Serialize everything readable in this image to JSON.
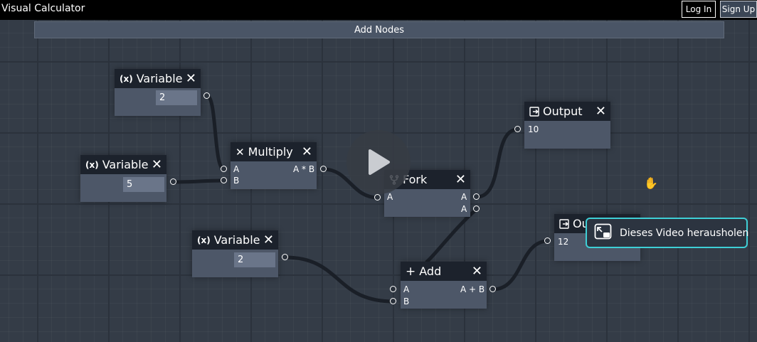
{
  "app": {
    "title": "Visual Calculator"
  },
  "auth": {
    "login_label": "Log In",
    "signup_label": "Sign Up"
  },
  "toolbar": {
    "add_nodes_label": "Add Nodes"
  },
  "nodes": {
    "variable1": {
      "title": "Variable",
      "icon": "x",
      "value": "2"
    },
    "variable2": {
      "title": "Variable",
      "icon": "x",
      "value": "5"
    },
    "variable3": {
      "title": "Variable",
      "icon": "x",
      "value": "2"
    },
    "multiply": {
      "title": "Multiply",
      "icon": "multiply-icon",
      "in_a": "A",
      "in_b": "B",
      "out": "A * B"
    },
    "fork": {
      "title": "Fork",
      "icon": "fork-icon",
      "in_a": "A",
      "out_1": "A",
      "out_2": "A"
    },
    "add": {
      "title": "Add",
      "icon": "plus-icon",
      "in_a": "A",
      "in_b": "B",
      "out": "A + B"
    },
    "output1": {
      "title": "Output",
      "icon": "output-icon",
      "value": "10"
    },
    "output2": {
      "title": "Output",
      "icon": "output-icon",
      "value": "12"
    }
  },
  "video_popout": {
    "label": "Dieses Video herausholen"
  },
  "colors": {
    "background": "#343c47",
    "node_body": "#4d5768",
    "node_header": "#1c222c",
    "accent": "#3ecfd6"
  }
}
